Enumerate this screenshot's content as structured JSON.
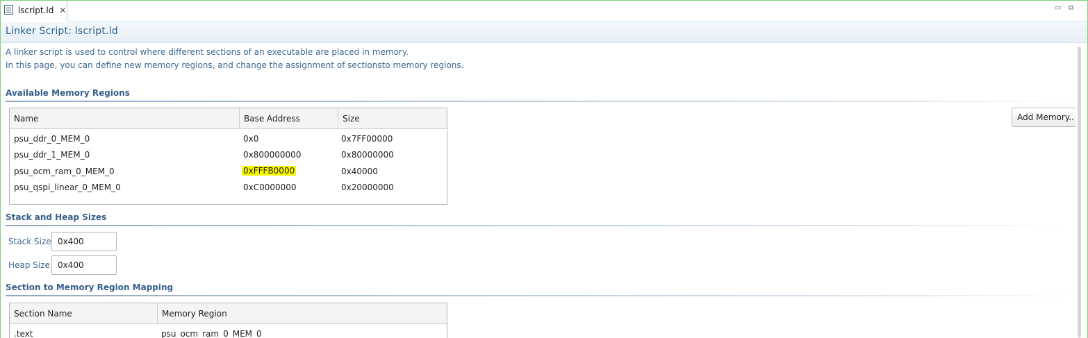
{
  "tab": {
    "title": "lscript.ld",
    "close_glyph": "✕",
    "icon": "linker-file-icon"
  },
  "window_controls": {
    "minimize_glyph": "▭",
    "restore_glyph": "⧉"
  },
  "header": {
    "title": "Linker Script: lscript.ld"
  },
  "description": {
    "line1": "A linker script is used to control where different sections of an executable are placed in memory.",
    "line2": "In this page, you can define new memory regions, and change the assignment of sectionsto memory regions."
  },
  "memory_regions": {
    "title": "Available Memory Regions",
    "columns": [
      "Name",
      "Base Address",
      "Size"
    ],
    "rows": [
      {
        "name": "psu_ddr_0_MEM_0",
        "base": "0x0",
        "size": "0x7FF00000"
      },
      {
        "name": "psu_ddr_1_MEM_0",
        "base": "0x800000000",
        "size": "0x80000000"
      },
      {
        "name": "psu_ocm_ram_0_MEM_0",
        "base": "0xFFFB0000",
        "size": "0x40000"
      },
      {
        "name": "psu_qspi_linear_0_MEM_0",
        "base": "0xC0000000",
        "size": "0x20000000"
      }
    ],
    "highlight_color": "#f7f700",
    "add_button_label": "Add Memory.."
  },
  "stack_heap": {
    "title": "Stack and Heap Sizes",
    "stack_label": "Stack Size",
    "stack_value": "0x400",
    "heap_label": "Heap Size",
    "heap_value": "0x400"
  },
  "section_mapping": {
    "title": "Section to Memory Region Mapping",
    "columns": [
      "Section Name",
      "Memory Region"
    ],
    "rows": [
      {
        "section": ".text",
        "region": "psu_ocm_ram_0_MEM_0"
      }
    ]
  },
  "colors": {
    "accent": "#365f8a",
    "frame": "#7fcf7f",
    "link_text": "#3d6a93"
  }
}
